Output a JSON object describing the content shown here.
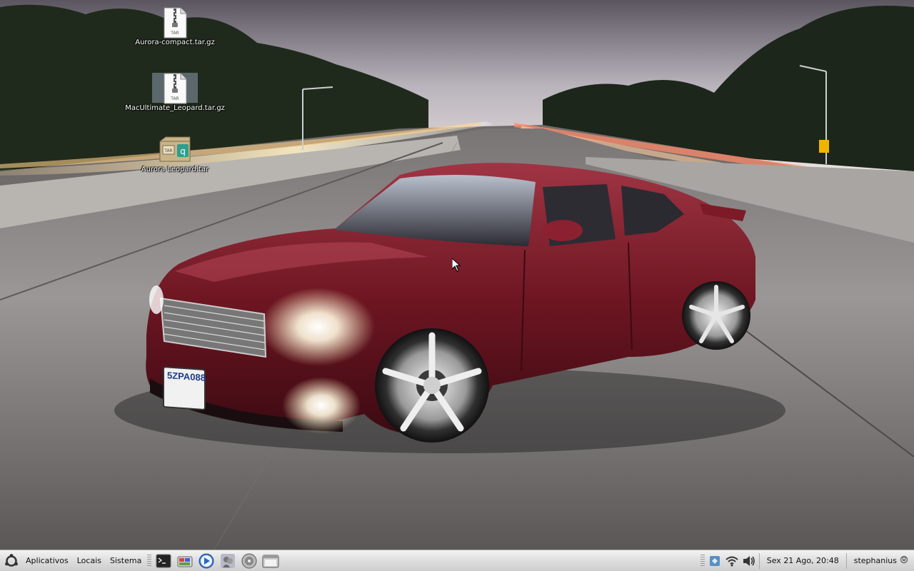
{
  "desktop": {
    "icons": [
      {
        "label": "Aurora-compact.tar.gz",
        "badge": "TAR",
        "type": "zip-archive-icon"
      },
      {
        "label": "MacUltimate_Leopard.tar.gz",
        "badge": "TAR",
        "type": "zip-archive-icon"
      },
      {
        "label": "Aurora Leopard.tar",
        "badge": "TAR",
        "type": "tar-package-icon"
      }
    ],
    "wallpaper": {
      "description_color": "#7a1e2a"
    },
    "license_plate": "5ZPA088"
  },
  "panel": {
    "menus": {
      "applications": "Aplicativos",
      "places": "Locais",
      "system": "Sistema"
    },
    "launchers": [
      "terminal-icon",
      "screenshot-icon",
      "media-player-icon",
      "pidgin-icon",
      "disk-utility-icon",
      "file-manager-icon"
    ],
    "tray": [
      "network-manager-icon",
      "wifi-icon",
      "volume-icon"
    ],
    "clock": "Sex 21 Ago, 20:48",
    "user": "stephanius"
  }
}
